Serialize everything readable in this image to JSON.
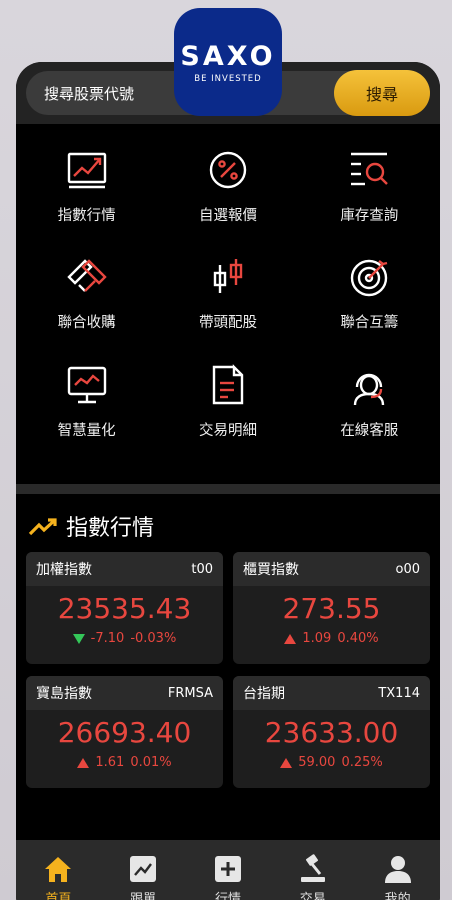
{
  "logo": {
    "brand": "SAXO",
    "tagline": "BE INVESTED"
  },
  "search": {
    "placeholder": "搜尋股票代號",
    "button": "搜尋"
  },
  "menu": [
    {
      "label": "指數行情",
      "icon": "line-chart-icon"
    },
    {
      "label": "自選報價",
      "icon": "percent-circle-icon"
    },
    {
      "label": "庫存查詢",
      "icon": "list-search-icon"
    },
    {
      "label": "聯合收購",
      "icon": "handshake-icon"
    },
    {
      "label": "帶頭配股",
      "icon": "candlestick-icon"
    },
    {
      "label": "聯合互籌",
      "icon": "target-icon"
    },
    {
      "label": "智慧量化",
      "icon": "monitor-chart-icon"
    },
    {
      "label": "交易明細",
      "icon": "document-icon"
    },
    {
      "label": "在線客服",
      "icon": "headset-icon"
    }
  ],
  "section": {
    "title": "指數行情"
  },
  "indices": [
    {
      "name": "加權指數",
      "code": "t00",
      "price": "23535.43",
      "change": "-7.10",
      "pct": "-0.03%",
      "direction": "down"
    },
    {
      "name": "櫃買指數",
      "code": "o00",
      "price": "273.55",
      "change": "1.09",
      "pct": "0.40%",
      "direction": "up"
    },
    {
      "name": "寶島指數",
      "code": "FRMSA",
      "price": "26693.40",
      "change": "1.61",
      "pct": "0.01%",
      "direction": "up"
    },
    {
      "name": "台指期",
      "code": "TX114",
      "price": "23633.00",
      "change": "59.00",
      "pct": "0.25%",
      "direction": "up"
    }
  ],
  "nav": [
    {
      "label": "首頁",
      "icon": "home-icon",
      "active": true
    },
    {
      "label": "跟單",
      "icon": "follow-chart-icon",
      "active": false
    },
    {
      "label": "行情",
      "icon": "market-plus-icon",
      "active": false
    },
    {
      "label": "交易",
      "icon": "gavel-icon",
      "active": false
    },
    {
      "label": "我的",
      "icon": "user-icon",
      "active": false
    }
  ],
  "colors": {
    "accent": "#f5b21e",
    "up": "#e8473f",
    "down": "#34c759",
    "logo_bg": "#0b2a8a"
  }
}
